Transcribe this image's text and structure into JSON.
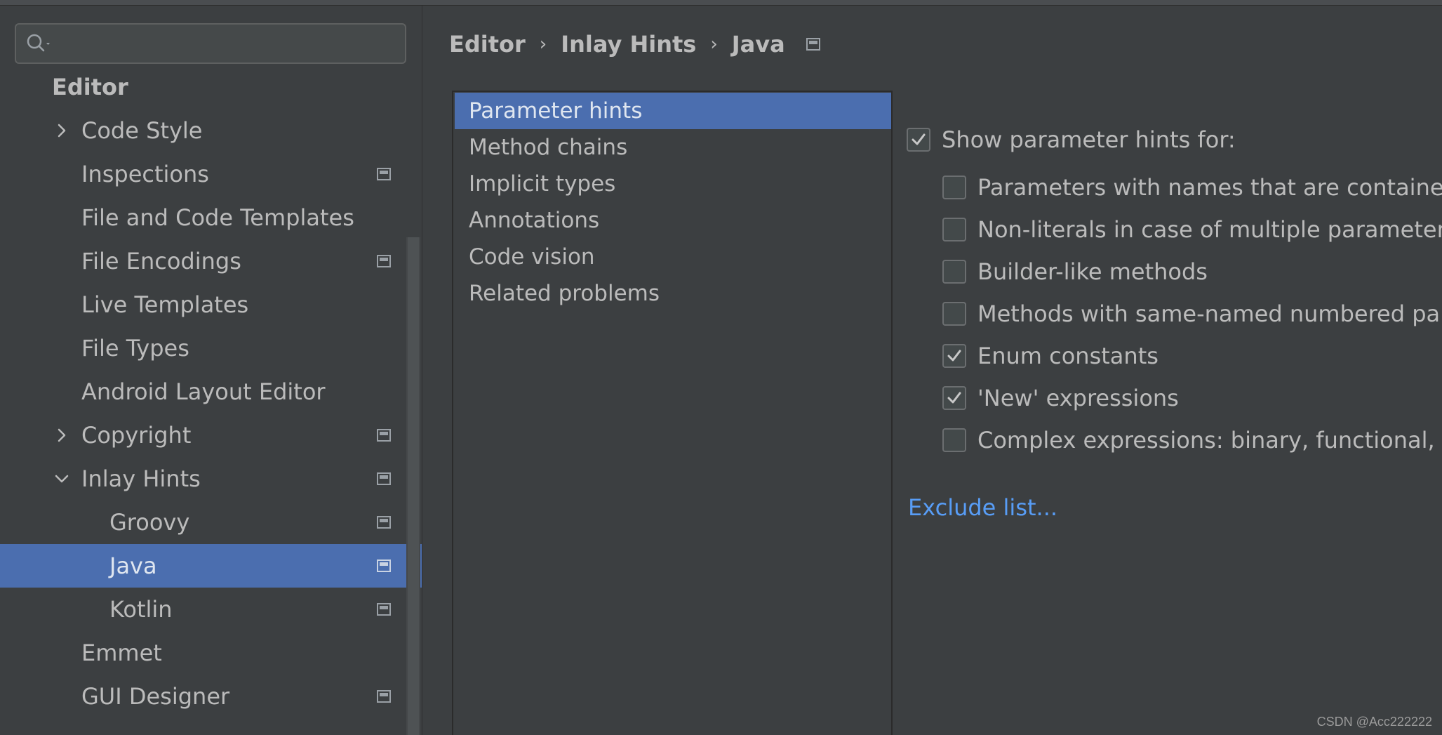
{
  "search": {
    "value": "",
    "placeholder": ""
  },
  "sidebar": {
    "section_title": "Editor",
    "items": [
      {
        "label": "Code Style",
        "chevron": "chevron-right-icon",
        "scope": false
      },
      {
        "label": "Inspections",
        "chevron": null,
        "scope": true
      },
      {
        "label": "File and Code Templates",
        "chevron": null,
        "scope": false
      },
      {
        "label": "File Encodings",
        "chevron": null,
        "scope": true
      },
      {
        "label": "Live Templates",
        "chevron": null,
        "scope": false
      },
      {
        "label": "File Types",
        "chevron": null,
        "scope": false
      },
      {
        "label": "Android Layout Editor",
        "chevron": null,
        "scope": false
      },
      {
        "label": "Copyright",
        "chevron": "chevron-right-icon",
        "scope": true
      },
      {
        "label": "Inlay Hints",
        "chevron": "chevron-down-icon",
        "scope": true
      },
      {
        "label": "Groovy",
        "chevron": null,
        "scope": true
      },
      {
        "label": "Java",
        "chevron": null,
        "scope": true,
        "selected": true
      },
      {
        "label": "Kotlin",
        "chevron": null,
        "scope": true
      },
      {
        "label": "Emmet",
        "chevron": null,
        "scope": false
      },
      {
        "label": "GUI Designer",
        "chevron": null,
        "scope": true
      }
    ]
  },
  "breadcrumb": {
    "items": [
      "Editor",
      "Inlay Hints",
      "Java"
    ],
    "separator": "›"
  },
  "hint_list": {
    "items": [
      {
        "label": "Parameter hints",
        "selected": true
      },
      {
        "label": "Method chains"
      },
      {
        "label": "Implicit types"
      },
      {
        "label": "Annotations"
      },
      {
        "label": "Code vision"
      },
      {
        "label": "Related problems"
      }
    ]
  },
  "settings": {
    "show_parameter_hints": {
      "label": "Show parameter hints for:",
      "checked": true
    },
    "options": [
      {
        "label": "Parameters with names that are contained",
        "checked": false
      },
      {
        "label": "Non-literals in case of multiple parameters",
        "checked": false
      },
      {
        "label": "Builder-like methods",
        "checked": false
      },
      {
        "label": "Methods with same-named numbered para",
        "checked": false
      },
      {
        "label": "Enum constants",
        "checked": true
      },
      {
        "label": "'New' expressions",
        "checked": true
      },
      {
        "label": "Complex expressions: binary, functional, ar",
        "checked": false
      }
    ],
    "exclude_link": "Exclude list..."
  },
  "watermark": "CSDN @Acc222222",
  "colors": {
    "background": "#3c3f41",
    "selection": "#4b6eaf",
    "text": "#bbbbbb",
    "link": "#589df6"
  }
}
